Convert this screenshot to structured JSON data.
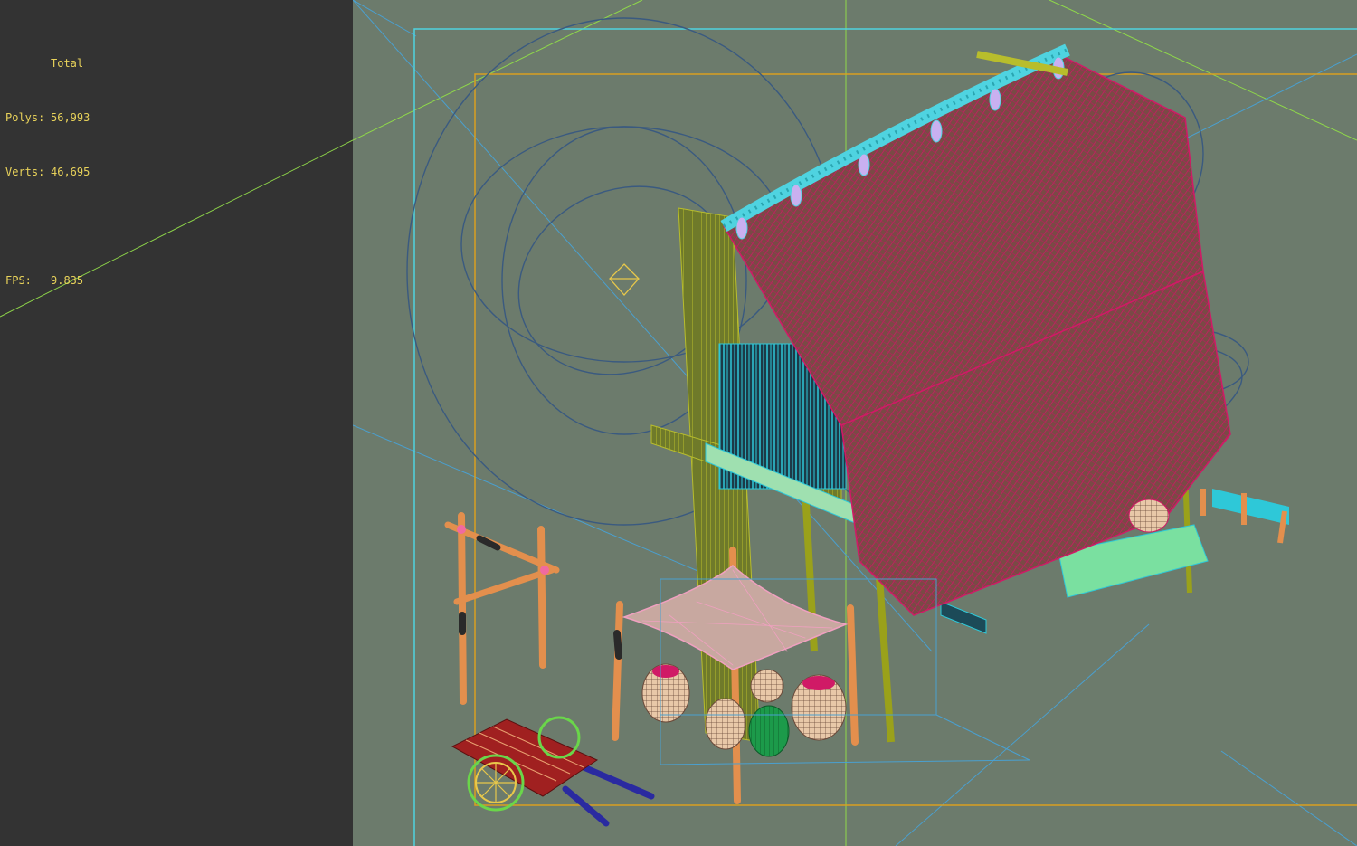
{
  "stats": {
    "header": "Total",
    "polys_label": "Polys:",
    "polys_value": "56,993",
    "verts_label": "Verts:",
    "verts_value": "46,695",
    "fps_label": "FPS:",
    "fps_value": "9.835"
  },
  "colors": {
    "panel_bg": "#333333",
    "viewport_bg": "#6c7b6c",
    "stats_text": "#e8d25a",
    "safe_frame_outer": "#4fd3e0",
    "safe_frame_inner": "#d9a020",
    "grid_line": "#8fd84a",
    "roof_wire": "#d01a66",
    "frame_wire": "#9aa11a",
    "rail_wire": "#2ec8d8",
    "pole": "#e38f4d",
    "cart": "#a02020"
  },
  "scene": {
    "objects": [
      "stilt-house",
      "thatched-roof",
      "drying-rack",
      "canopy-cloth",
      "jars",
      "hand-cart",
      "light-gizmos"
    ]
  }
}
